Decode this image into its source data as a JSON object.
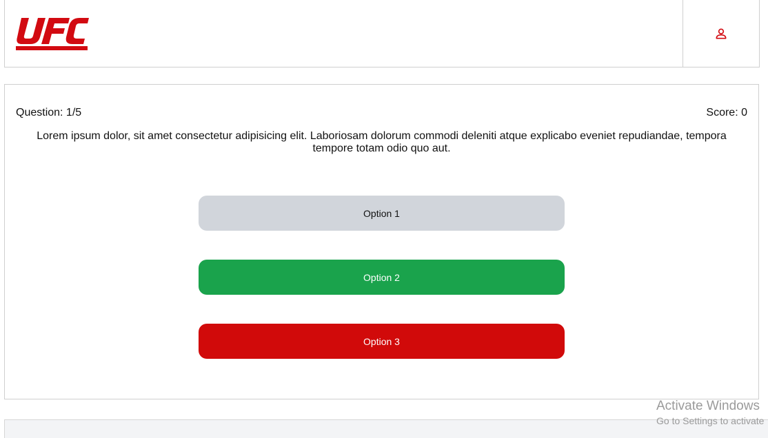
{
  "header": {
    "logo_text": "UFC",
    "user_icon": "user-icon"
  },
  "quiz": {
    "question_counter": "Question: 1/5",
    "score": "Score: 0",
    "question_text": "Lorem ipsum dolor, sit amet consectetur adipisicing elit. Laboriosam dolorum commodi deleniti atque explicabo eveniet repudiandae, tempora tempore totam odio quo aut.",
    "options": [
      {
        "label": "Option 1",
        "state": "neutral",
        "color": "#d1d5db"
      },
      {
        "label": "Option 2",
        "state": "correct",
        "color": "#1aa34c"
      },
      {
        "label": "Option 3",
        "state": "incorrect",
        "color": "#d10a0a"
      }
    ]
  },
  "colors": {
    "brand": "#d20a11"
  },
  "watermark": {
    "title": "Activate Windows",
    "subtitle": "Go to Settings to activate"
  }
}
